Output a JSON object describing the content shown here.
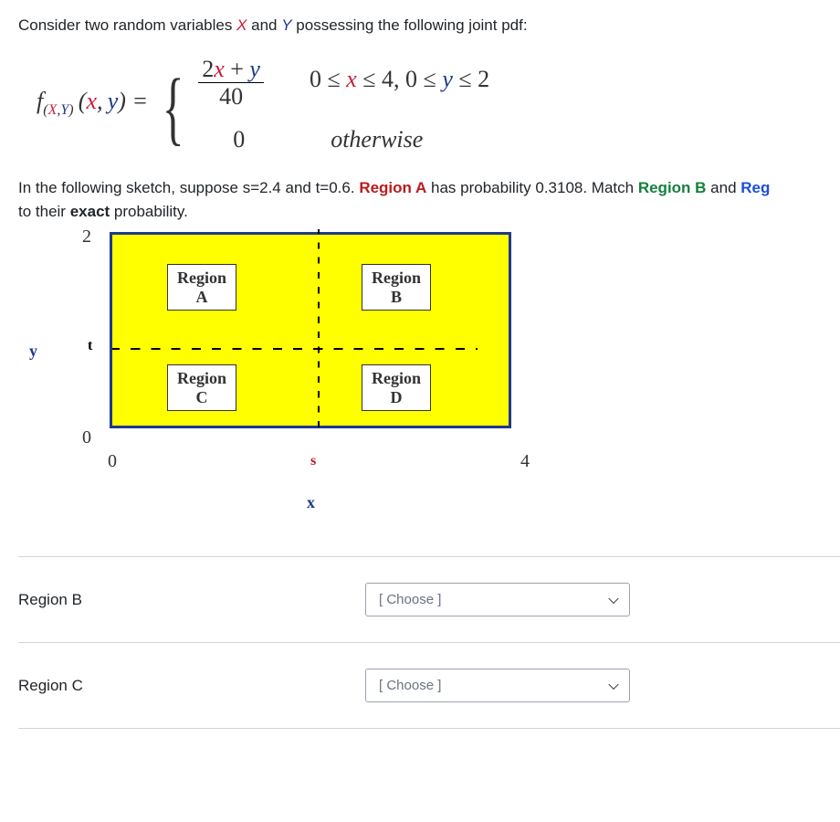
{
  "question": {
    "intro_prefix": "Consider two random variables ",
    "x_token": "X",
    "and_token": " and ",
    "y_token": "Y",
    "intro_suffix": " possessing the following joint pdf:"
  },
  "formula": {
    "lhs_f": "f",
    "lhs_sub_open": "(",
    "lhs_sub_x": "X",
    "lhs_sub_comma": ",",
    "lhs_sub_y": "Y",
    "lhs_sub_close": ")",
    "lhs_args": "(x, y)",
    "eq": " = ",
    "case1_num_a": "2",
    "case1_num_x": "x",
    "case1_num_plus": " + ",
    "case1_num_y": "y",
    "case1_den": "40",
    "case1_cond_a": "0 ≤ ",
    "case1_cond_x": "x",
    "case1_cond_b": " ≤ 4, 0 ≤ ",
    "case1_cond_y": "y",
    "case1_cond_c": " ≤ 2",
    "case2_val": "0",
    "case2_cond": "otherwise"
  },
  "body": {
    "p1": "In the following sketch, suppose s=2.4 and t=0.6.  ",
    "regionA_name": "Region A",
    "p2": " has probability 0.3108.  Match ",
    "regionB_name": "Region B",
    "p3": " and ",
    "regionC_name": "Reg",
    "p4": "to their ",
    "exact": "exact",
    "p5": " probability."
  },
  "sketch": {
    "y_axis": "y",
    "x_axis": "x",
    "y_tick_top": "2",
    "y_tick_bottom": "0",
    "x_tick_left": "0",
    "x_tick_right": "4",
    "t_label": "t",
    "s_label": "s",
    "regionA": "Region\nA",
    "regionB": "Region\nB",
    "regionC": "Region\nC",
    "regionD": "Region\nD"
  },
  "matches": {
    "rowB_label": "Region B",
    "rowC_label": "Region C",
    "placeholder": "[ Choose ]"
  }
}
